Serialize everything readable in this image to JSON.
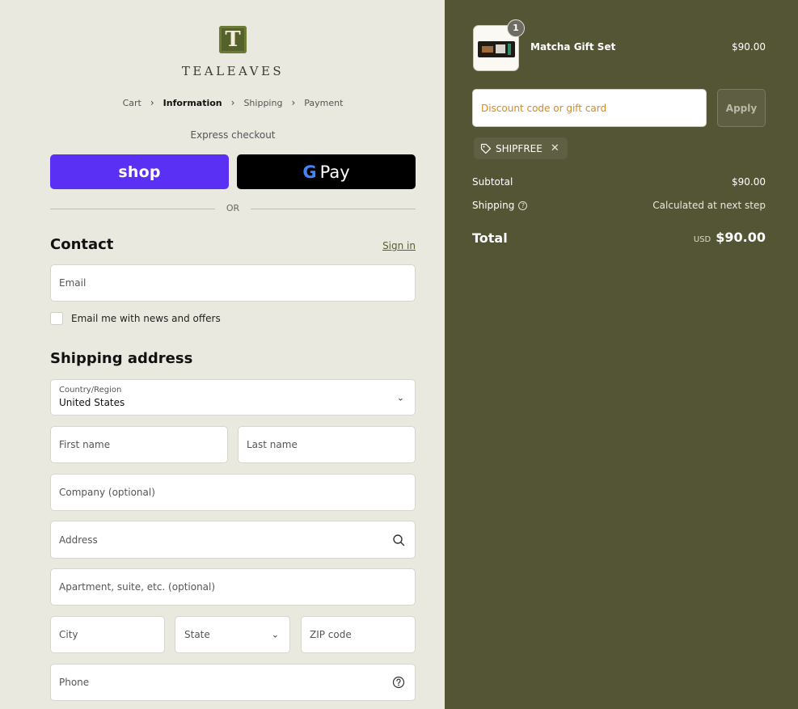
{
  "brand": {
    "logo_letter": "T",
    "name": "TEALEAVES"
  },
  "breadcrumb": {
    "items": [
      "Cart",
      "Information",
      "Shipping",
      "Payment"
    ],
    "current": "Information"
  },
  "express": {
    "label": "Express checkout",
    "shop_label": "shop",
    "gpay_label": "Pay",
    "gpay_g": "G",
    "or": "OR"
  },
  "contact": {
    "title": "Contact",
    "sign_in": "Sign in",
    "email_placeholder": "Email",
    "newsletter_label": "Email me with news and offers"
  },
  "shipping": {
    "title": "Shipping address",
    "country_label": "Country/Region",
    "country_value": "United States",
    "first_name_placeholder": "First name",
    "last_name_placeholder": "Last name",
    "company_placeholder": "Company (optional)",
    "address_placeholder": "Address",
    "apartment_placeholder": "Apartment, suite, etc. (optional)",
    "city_placeholder": "City",
    "state_label": "State",
    "zip_placeholder": "ZIP code",
    "phone_placeholder": "Phone"
  },
  "summary": {
    "item": {
      "name": "Matcha Gift Set",
      "price": "$90.00",
      "quantity": "1"
    },
    "discount_placeholder": "Discount code or gift card",
    "apply_label": "Apply",
    "applied_code": "SHIPFREE",
    "subtotal_label": "Subtotal",
    "subtotal_value": "$90.00",
    "shipping_label": "Shipping",
    "shipping_value": "Calculated at next step",
    "total_label": "Total",
    "total_currency": "USD",
    "total_value": "$90.00"
  },
  "colors": {
    "left_bg": "#e9e9df",
    "right_bg": "#545535",
    "shop_pay": "#5a31f4",
    "brand_green": "#55612a",
    "discount_placeholder": "#d68a1b"
  }
}
